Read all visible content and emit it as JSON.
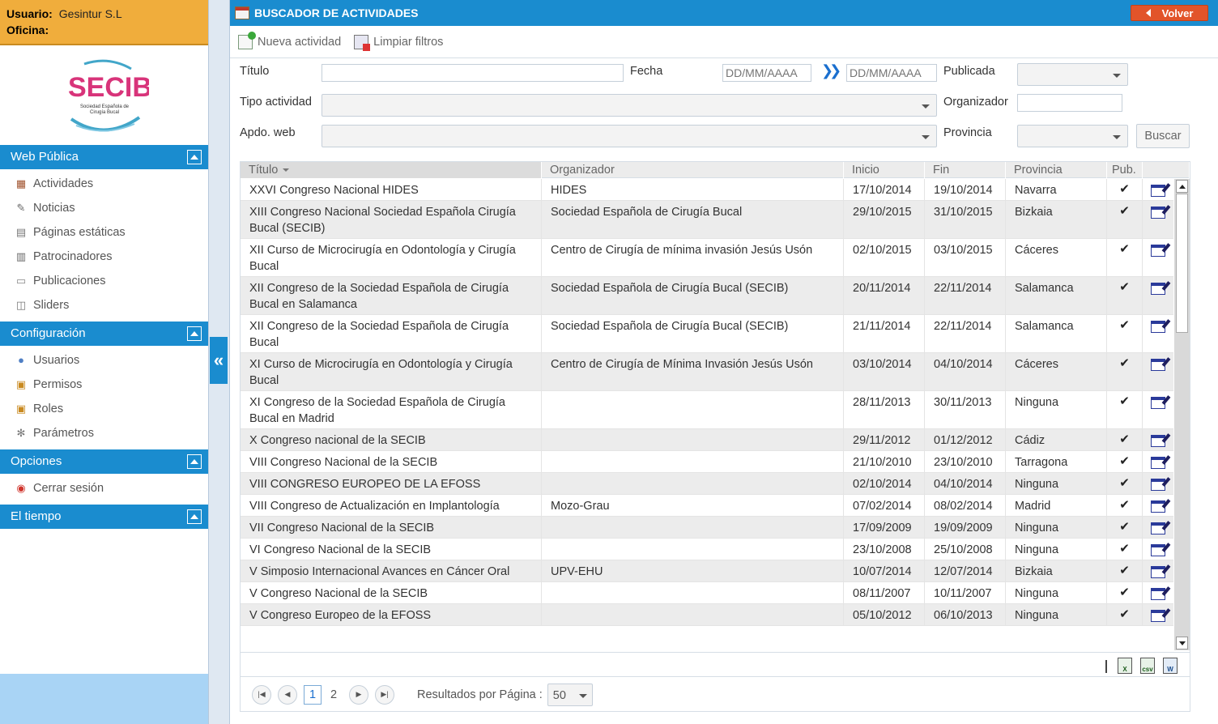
{
  "user": {
    "usuario_label": "Usuario:",
    "usuario_value": "Gesintur S.L",
    "oficina_label": "Oficina:"
  },
  "logo": {
    "text": "SECIB",
    "subtitle_1": "Sociedad Española de",
    "subtitle_2": "Cirugía Bucal"
  },
  "sidebar": {
    "sections": [
      {
        "title": "Web Pública",
        "items": [
          {
            "label": "Actividades",
            "icon": "calendar-icon"
          },
          {
            "label": "Noticias",
            "icon": "news-icon"
          },
          {
            "label": "Páginas estáticas",
            "icon": "page-icon"
          },
          {
            "label": "Patrocinadores",
            "icon": "sponsor-icon"
          },
          {
            "label": "Publicaciones",
            "icon": "publication-icon"
          },
          {
            "label": "Sliders",
            "icon": "slider-icon"
          }
        ]
      },
      {
        "title": "Configuración",
        "items": [
          {
            "label": "Usuarios",
            "icon": "users-icon"
          },
          {
            "label": "Permisos",
            "icon": "lock-icon"
          },
          {
            "label": "Roles",
            "icon": "lock-icon"
          },
          {
            "label": "Parámetros",
            "icon": "gear-icon"
          }
        ]
      },
      {
        "title": "Opciones",
        "items": [
          {
            "label": "Cerrar sesión",
            "icon": "power-icon"
          }
        ]
      },
      {
        "title": "El tiempo",
        "items": []
      }
    ]
  },
  "header": {
    "title": "BUSCADOR DE ACTIVIDADES",
    "back_label": "Volver"
  },
  "toolbar": {
    "new_label": "Nueva actividad",
    "clear_label": "Limpiar filtros"
  },
  "filters": {
    "titulo_label": "Título",
    "fecha_label": "Fecha",
    "date_from_placeholder": "DD/MM/AAAA",
    "date_to_placeholder": "DD/MM/AAAA",
    "publicada_label": "Publicada",
    "tipo_label": "Tipo actividad",
    "organizador_label": "Organizador",
    "apdo_label": "Apdo. web",
    "provincia_label": "Provincia",
    "buscar_label": "Buscar"
  },
  "grid": {
    "columns": [
      "Título",
      "Organizador",
      "Inicio",
      "Fin",
      "Provincia",
      "Pub."
    ],
    "rows": [
      {
        "titulo": "XXVI Congreso Nacional HIDES",
        "organizador": "HIDES",
        "inicio": "17/10/2014",
        "fin": "19/10/2014",
        "provincia": "Navarra"
      },
      {
        "titulo": "XIII Congreso Nacional Sociedad Española Cirugía Bucal (SECIB)",
        "organizador": "Sociedad Española de Cirugía Bucal",
        "inicio": "29/10/2015",
        "fin": "31/10/2015",
        "provincia": "Bizkaia"
      },
      {
        "titulo": "XII Curso de Microcirugía en Odontología y Cirugía Bucal",
        "organizador": "Centro de Cirugía de mínima invasión Jesús Usón",
        "inicio": "02/10/2015",
        "fin": "03/10/2015",
        "provincia": "Cáceres"
      },
      {
        "titulo": "XII Congreso de la Sociedad Española de Cirugía Bucal en Salamanca",
        "organizador": "Sociedad Española de Cirugía Bucal (SECIB)",
        "inicio": "20/11/2014",
        "fin": "22/11/2014",
        "provincia": "Salamanca"
      },
      {
        "titulo": "XII Congreso de la Sociedad Española de Cirugía Bucal",
        "organizador": "Sociedad Española de Cirugía Bucal (SECIB)",
        "inicio": "21/11/2014",
        "fin": "22/11/2014",
        "provincia": "Salamanca"
      },
      {
        "titulo": "XI Curso de Microcirugía en Odontología y Cirugía Bucal",
        "organizador": "Centro de Cirugía de Mínima Invasión Jesús Usón",
        "inicio": "03/10/2014",
        "fin": "04/10/2014",
        "provincia": "Cáceres"
      },
      {
        "titulo": "XI Congreso de la Sociedad Española de Cirugía Bucal en Madrid",
        "organizador": "",
        "inicio": "28/11/2013",
        "fin": "30/11/2013",
        "provincia": "Ninguna"
      },
      {
        "titulo": "X Congreso nacional de la SECIB",
        "organizador": "",
        "inicio": "29/11/2012",
        "fin": "01/12/2012",
        "provincia": "Cádiz"
      },
      {
        "titulo": "VIII Congreso Nacional de la SECIB",
        "organizador": "",
        "inicio": "21/10/2010",
        "fin": "23/10/2010",
        "provincia": "Tarragona"
      },
      {
        "titulo": "VIII CONGRESO EUROPEO DE LA EFOSS",
        "organizador": "",
        "inicio": "02/10/2014",
        "fin": "04/10/2014",
        "provincia": "Ninguna"
      },
      {
        "titulo": "VIII Congreso de Actualización en Implantología",
        "organizador": "Mozo-Grau",
        "inicio": "07/02/2014",
        "fin": "08/02/2014",
        "provincia": "Madrid"
      },
      {
        "titulo": "VII Congreso Nacional de la SECIB",
        "organizador": "",
        "inicio": "17/09/2009",
        "fin": "19/09/2009",
        "provincia": "Ninguna"
      },
      {
        "titulo": "VI Congreso Nacional de la SECIB",
        "organizador": "",
        "inicio": "23/10/2008",
        "fin": "25/10/2008",
        "provincia": "Ninguna"
      },
      {
        "titulo": "V Simposio Internacional Avances en Cáncer Oral",
        "organizador": "UPV-EHU",
        "inicio": "10/07/2014",
        "fin": "12/07/2014",
        "provincia": "Bizkaia"
      },
      {
        "titulo": "V Congreso Nacional de la SECIB",
        "organizador": "",
        "inicio": "08/11/2007",
        "fin": "10/11/2007",
        "provincia": "Ninguna"
      },
      {
        "titulo": "V Congreso Europeo de la EFOSS",
        "organizador": "",
        "inicio": "05/10/2012",
        "fin": "06/10/2013",
        "provincia": "Ninguna"
      }
    ],
    "check_glyph": "✔"
  },
  "export": {
    "csv_label": "csv"
  },
  "pager": {
    "pages": [
      "1",
      "2"
    ],
    "current": "1",
    "per_page_label": "Resultados por Página :",
    "per_page_value": "50"
  },
  "colors": {
    "accent": "#1a8ccf",
    "user_bg": "#f0ad3c",
    "back_btn": "#e2542a"
  }
}
